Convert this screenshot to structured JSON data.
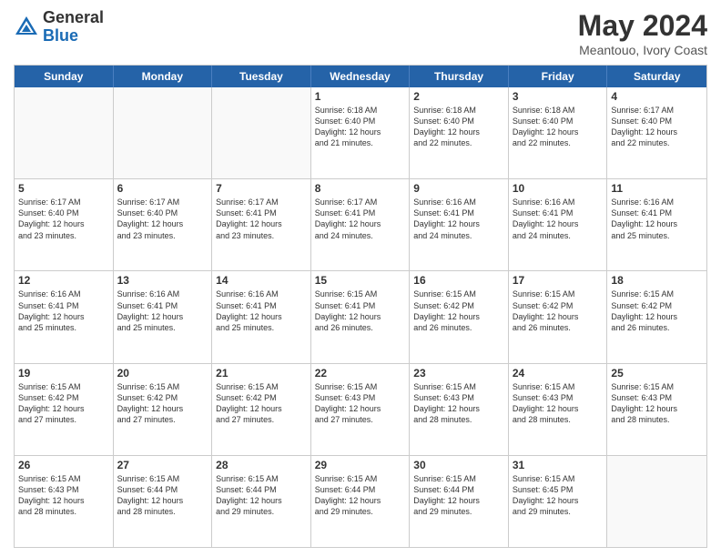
{
  "header": {
    "logo_general": "General",
    "logo_blue": "Blue",
    "month_title": "May 2024",
    "location": "Meantouo, Ivory Coast"
  },
  "calendar": {
    "days_of_week": [
      "Sunday",
      "Monday",
      "Tuesday",
      "Wednesday",
      "Thursday",
      "Friday",
      "Saturday"
    ],
    "weeks": [
      [
        {
          "day": "",
          "info": ""
        },
        {
          "day": "",
          "info": ""
        },
        {
          "day": "",
          "info": ""
        },
        {
          "day": "1",
          "info": "Sunrise: 6:18 AM\nSunset: 6:40 PM\nDaylight: 12 hours\nand 21 minutes."
        },
        {
          "day": "2",
          "info": "Sunrise: 6:18 AM\nSunset: 6:40 PM\nDaylight: 12 hours\nand 22 minutes."
        },
        {
          "day": "3",
          "info": "Sunrise: 6:18 AM\nSunset: 6:40 PM\nDaylight: 12 hours\nand 22 minutes."
        },
        {
          "day": "4",
          "info": "Sunrise: 6:17 AM\nSunset: 6:40 PM\nDaylight: 12 hours\nand 22 minutes."
        }
      ],
      [
        {
          "day": "5",
          "info": "Sunrise: 6:17 AM\nSunset: 6:40 PM\nDaylight: 12 hours\nand 23 minutes."
        },
        {
          "day": "6",
          "info": "Sunrise: 6:17 AM\nSunset: 6:40 PM\nDaylight: 12 hours\nand 23 minutes."
        },
        {
          "day": "7",
          "info": "Sunrise: 6:17 AM\nSunset: 6:41 PM\nDaylight: 12 hours\nand 23 minutes."
        },
        {
          "day": "8",
          "info": "Sunrise: 6:17 AM\nSunset: 6:41 PM\nDaylight: 12 hours\nand 24 minutes."
        },
        {
          "day": "9",
          "info": "Sunrise: 6:16 AM\nSunset: 6:41 PM\nDaylight: 12 hours\nand 24 minutes."
        },
        {
          "day": "10",
          "info": "Sunrise: 6:16 AM\nSunset: 6:41 PM\nDaylight: 12 hours\nand 24 minutes."
        },
        {
          "day": "11",
          "info": "Sunrise: 6:16 AM\nSunset: 6:41 PM\nDaylight: 12 hours\nand 25 minutes."
        }
      ],
      [
        {
          "day": "12",
          "info": "Sunrise: 6:16 AM\nSunset: 6:41 PM\nDaylight: 12 hours\nand 25 minutes."
        },
        {
          "day": "13",
          "info": "Sunrise: 6:16 AM\nSunset: 6:41 PM\nDaylight: 12 hours\nand 25 minutes."
        },
        {
          "day": "14",
          "info": "Sunrise: 6:16 AM\nSunset: 6:41 PM\nDaylight: 12 hours\nand 25 minutes."
        },
        {
          "day": "15",
          "info": "Sunrise: 6:15 AM\nSunset: 6:41 PM\nDaylight: 12 hours\nand 26 minutes."
        },
        {
          "day": "16",
          "info": "Sunrise: 6:15 AM\nSunset: 6:42 PM\nDaylight: 12 hours\nand 26 minutes."
        },
        {
          "day": "17",
          "info": "Sunrise: 6:15 AM\nSunset: 6:42 PM\nDaylight: 12 hours\nand 26 minutes."
        },
        {
          "day": "18",
          "info": "Sunrise: 6:15 AM\nSunset: 6:42 PM\nDaylight: 12 hours\nand 26 minutes."
        }
      ],
      [
        {
          "day": "19",
          "info": "Sunrise: 6:15 AM\nSunset: 6:42 PM\nDaylight: 12 hours\nand 27 minutes."
        },
        {
          "day": "20",
          "info": "Sunrise: 6:15 AM\nSunset: 6:42 PM\nDaylight: 12 hours\nand 27 minutes."
        },
        {
          "day": "21",
          "info": "Sunrise: 6:15 AM\nSunset: 6:42 PM\nDaylight: 12 hours\nand 27 minutes."
        },
        {
          "day": "22",
          "info": "Sunrise: 6:15 AM\nSunset: 6:43 PM\nDaylight: 12 hours\nand 27 minutes."
        },
        {
          "day": "23",
          "info": "Sunrise: 6:15 AM\nSunset: 6:43 PM\nDaylight: 12 hours\nand 28 minutes."
        },
        {
          "day": "24",
          "info": "Sunrise: 6:15 AM\nSunset: 6:43 PM\nDaylight: 12 hours\nand 28 minutes."
        },
        {
          "day": "25",
          "info": "Sunrise: 6:15 AM\nSunset: 6:43 PM\nDaylight: 12 hours\nand 28 minutes."
        }
      ],
      [
        {
          "day": "26",
          "info": "Sunrise: 6:15 AM\nSunset: 6:43 PM\nDaylight: 12 hours\nand 28 minutes."
        },
        {
          "day": "27",
          "info": "Sunrise: 6:15 AM\nSunset: 6:44 PM\nDaylight: 12 hours\nand 28 minutes."
        },
        {
          "day": "28",
          "info": "Sunrise: 6:15 AM\nSunset: 6:44 PM\nDaylight: 12 hours\nand 29 minutes."
        },
        {
          "day": "29",
          "info": "Sunrise: 6:15 AM\nSunset: 6:44 PM\nDaylight: 12 hours\nand 29 minutes."
        },
        {
          "day": "30",
          "info": "Sunrise: 6:15 AM\nSunset: 6:44 PM\nDaylight: 12 hours\nand 29 minutes."
        },
        {
          "day": "31",
          "info": "Sunrise: 6:15 AM\nSunset: 6:45 PM\nDaylight: 12 hours\nand 29 minutes."
        },
        {
          "day": "",
          "info": ""
        }
      ]
    ]
  }
}
